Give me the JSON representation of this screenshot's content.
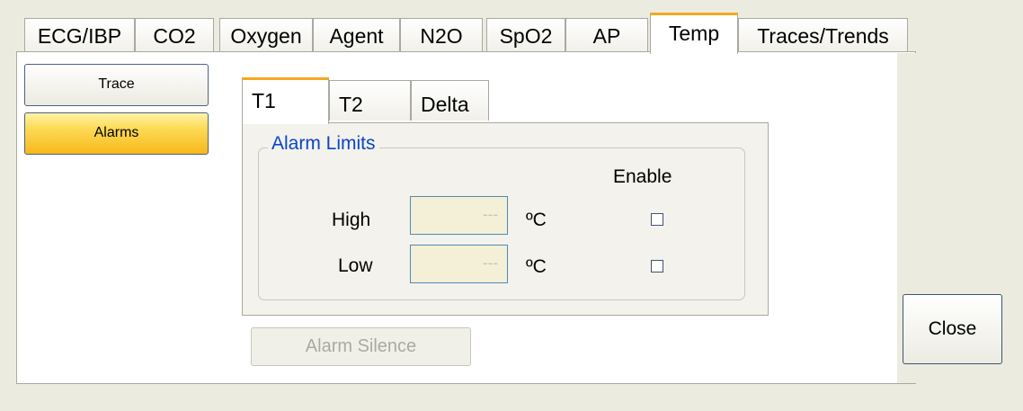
{
  "top_tabs": [
    "ECG/IBP",
    "CO2",
    "Oxygen",
    "Agent",
    "N2O",
    "SpO2",
    "AP",
    "Temp",
    "Traces/Trends"
  ],
  "active_tab": "Temp",
  "side_buttons": {
    "trace": "Trace",
    "alarms": "Alarms"
  },
  "sub_tabs": [
    "T1",
    "T2",
    "Delta"
  ],
  "active_sub_tab": "T1",
  "alarm_limits": {
    "title": "Alarm Limits",
    "enable_label": "Enable",
    "high": {
      "label": "High",
      "value": "---",
      "unit": "ºC",
      "enabled": false
    },
    "low": {
      "label": "Low",
      "value": "---",
      "unit": "ºC",
      "enabled": false
    }
  },
  "alarm_silence_label": "Alarm Silence",
  "close_label": "Close",
  "colors": {
    "accent": "#f4a81f",
    "group_title": "#0b45c8",
    "field_bg": "#f4f0d8"
  }
}
